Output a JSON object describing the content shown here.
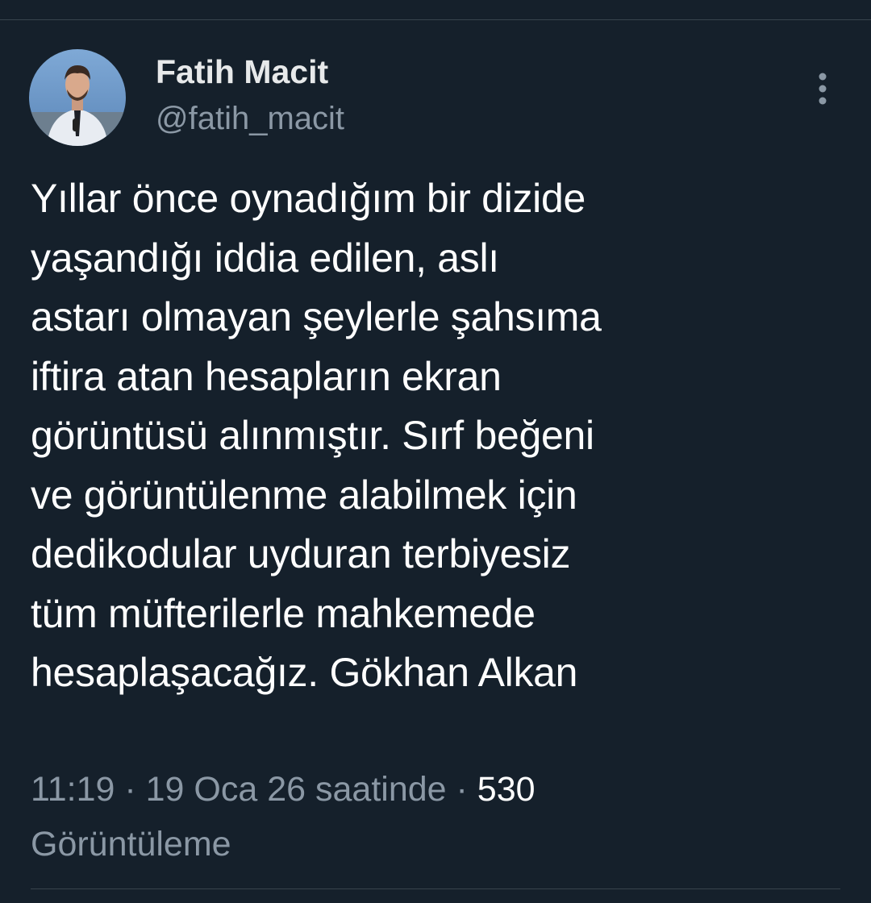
{
  "tweet": {
    "author": {
      "display_name": "Fatih Macit",
      "handle": "@fatih_macit"
    },
    "more_icon": "more-vertical-icon",
    "text": "Yıllar önce oynadığım bir dizide\nyaşandığı iddia edilen, aslı\nastarı olmayan şeylerle şahsıma\niftira atan hesapların ekran\ngörüntüsü alınmıştır. Sırf beğeni\nve görüntülenme alabilmek için\ndedikodular uyduran terbiyesiz\ntüm müfterilerle mahkemede\nhesaplaşacağız. Gökhan Alkan",
    "meta": {
      "time": "11:19",
      "separator": " · ",
      "date": "19 Oca 26 saatinde",
      "views_count": "530",
      "views_label": "Görüntüleme"
    }
  },
  "colors": {
    "background": "#15202b",
    "primary_text": "#ffffff",
    "secondary_text": "#8b98a5",
    "divider": "#38444d"
  }
}
